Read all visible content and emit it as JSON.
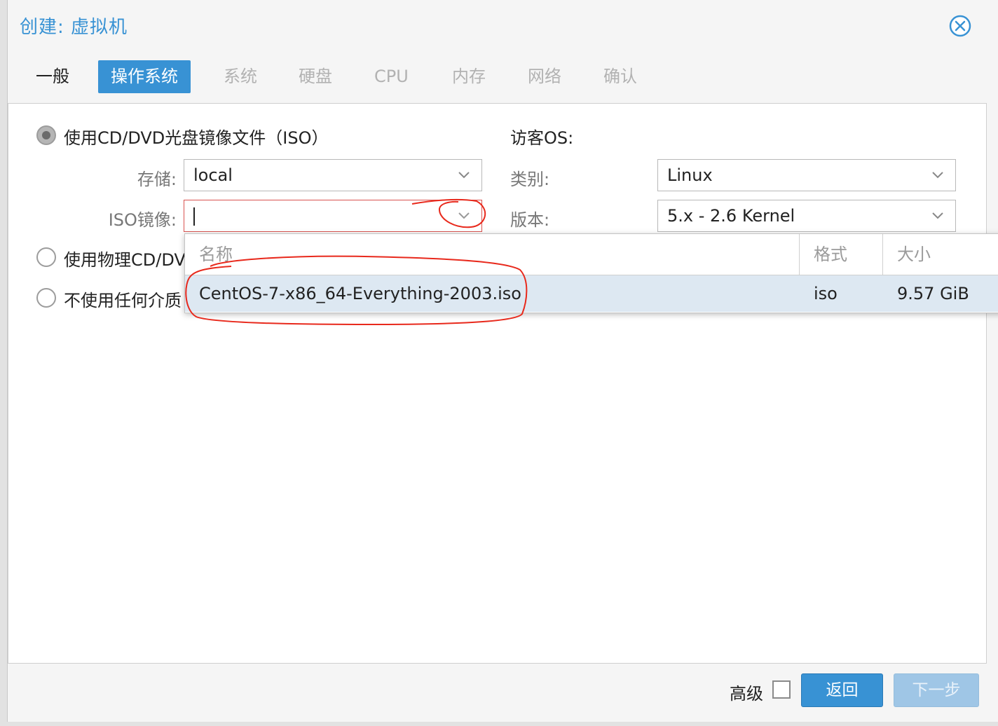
{
  "window": {
    "title": "创建: 虚拟机"
  },
  "tabs": [
    {
      "label": "一般"
    },
    {
      "label": "操作系统"
    },
    {
      "label": "系统"
    },
    {
      "label": "硬盘"
    },
    {
      "label": "CPU"
    },
    {
      "label": "内存"
    },
    {
      "label": "网络"
    },
    {
      "label": "确认"
    }
  ],
  "media": {
    "option_iso": "使用CD/DVD光盘镜像文件（ISO）",
    "option_physical": "使用物理CD/DVD",
    "option_none": "不使用任何介质",
    "storage_label": "存储:",
    "storage_value": "local",
    "iso_label": "ISO镜像:",
    "iso_value": ""
  },
  "guest": {
    "heading": "访客OS:",
    "type_label": "类别:",
    "type_value": "Linux",
    "version_label": "版本:",
    "version_value": "5.x - 2.6 Kernel"
  },
  "iso_dropdown": {
    "columns": [
      "名称",
      "格式",
      "大小"
    ],
    "rows": [
      {
        "name": "CentOS-7-x86_64-Everything-2003.iso",
        "format": "iso",
        "size": "9.57 GiB"
      }
    ]
  },
  "footer": {
    "advanced_label": "高级",
    "back_label": "返回",
    "next_label": "下一步"
  },
  "colors": {
    "accent": "#3892d4",
    "annotation": "#e8291c",
    "selected_row": "#dde8f2"
  }
}
